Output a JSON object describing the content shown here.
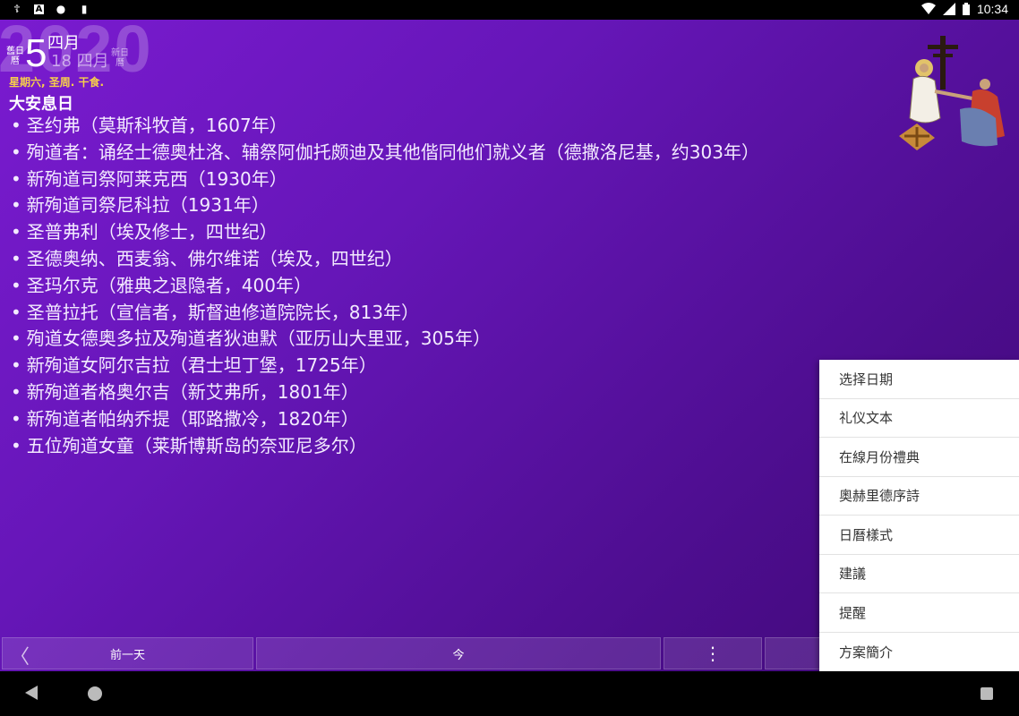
{
  "status_bar": {
    "left_icons": [
      "orthodox-cross-icon",
      "font-a-icon",
      "circle-icon",
      "sd-card-icon"
    ],
    "left_glyphs": [
      "☦",
      "A",
      "●",
      "▮"
    ],
    "time": "10:34"
  },
  "header": {
    "year": "2020",
    "old_calendar_label": "舊日曆",
    "day": "5",
    "month": "四月",
    "new_calendar_date": "18 四月",
    "new_calendar_label": "新日曆",
    "day_info": "星期六, 圣周. 干食.",
    "feast_title": "大安息日"
  },
  "saints": [
    "圣约弗（莫斯科牧首，1607年）",
    "殉道者：诵经士德奥杜洛、辅祭阿伽托颇迪及其他偕同他们就义者（德撒洛尼基，约303年）",
    "新殉道司祭阿莱克西（1930年）",
    "新殉道司祭尼科拉（1931年）",
    "圣普弗利（埃及修士，四世纪）",
    "圣德奥纳、西麦翁、佛尔维诺（埃及，四世纪）",
    "圣玛尔克（雅典之退隐者，400年）",
    "圣普拉托（宣信者，斯督迪修道院院长，813年）",
    "殉道女德奥多拉及殉道者狄迪默（亚历山大里亚，305年）",
    "新殉道女阿尔吉拉（君士坦丁堡，1725年）",
    "新殉道者格奥尔吉（新艾弗所，1801年）",
    "新殉道者帕纳乔提（耶路撒冷，1820年）",
    "五位殉道女童（莱斯博斯岛的奈亚尼多尔）"
  ],
  "toolbar": {
    "prev_label": "前一天",
    "today_label": "今",
    "more_glyph": "⋮",
    "prev_chevron": "〈"
  },
  "menu": {
    "items": [
      "选择日期",
      "礼仪文本",
      "在線月份禮典",
      "奧赫里德序詩",
      "日曆樣式",
      "建議",
      "提醒",
      "方案簡介"
    ]
  },
  "colors": {
    "background_start": "#7a1bd0",
    "background_end": "#3f0a75",
    "day_info": "#f7d04a",
    "menu_background": "#ffffff"
  }
}
